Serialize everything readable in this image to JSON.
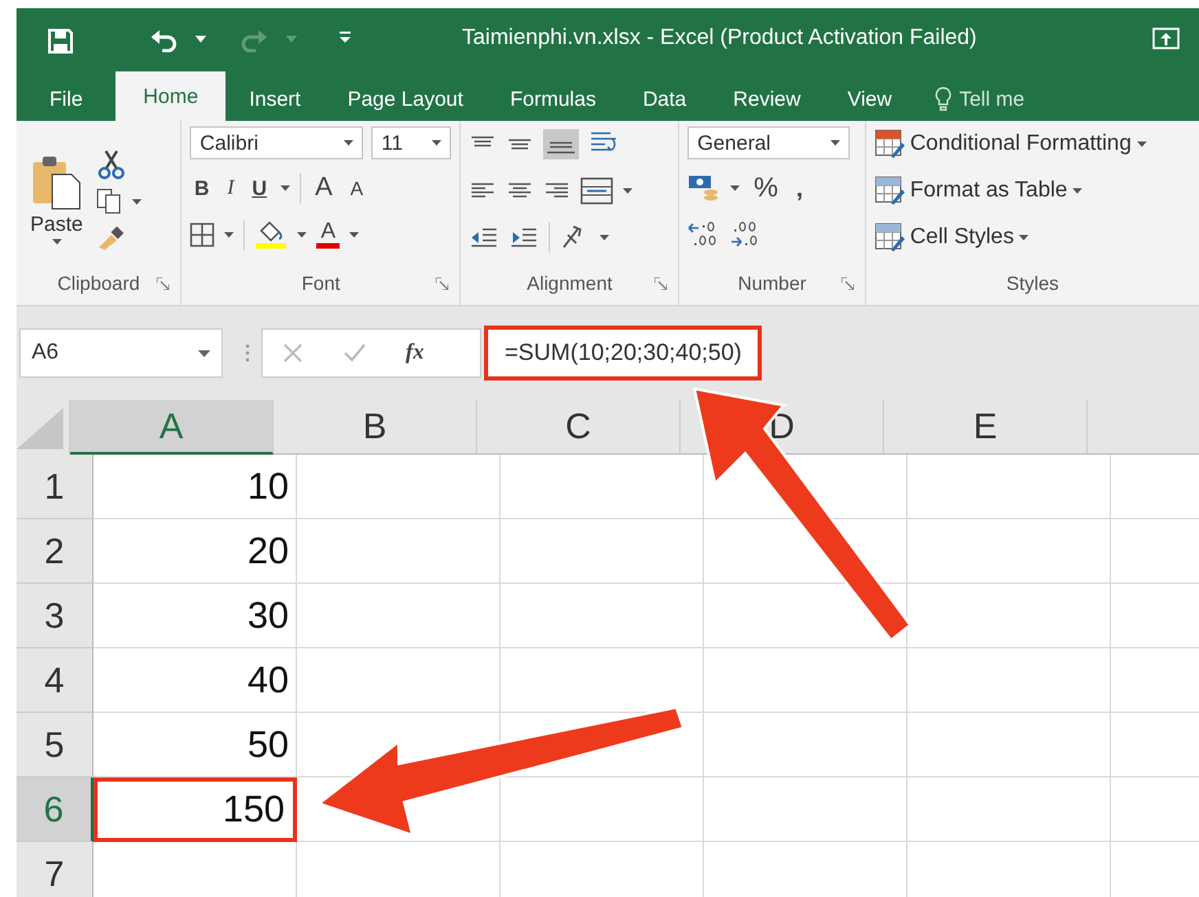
{
  "window": {
    "title": "Taimienphi.vn.xlsx - Excel (Product Activation Failed)"
  },
  "tabs": [
    {
      "label": "File",
      "selected": false
    },
    {
      "label": "Home",
      "selected": true
    },
    {
      "label": "Insert",
      "selected": false
    },
    {
      "label": "Page Layout",
      "selected": false
    },
    {
      "label": "Formulas",
      "selected": false
    },
    {
      "label": "Data",
      "selected": false
    },
    {
      "label": "Review",
      "selected": false
    },
    {
      "label": "View",
      "selected": false
    }
  ],
  "tell_me": "Tell me",
  "ribbon": {
    "clipboard": {
      "label": "Clipboard",
      "paste": "Paste"
    },
    "font": {
      "label": "Font",
      "name": "Calibri",
      "size": "11",
      "bold": "B",
      "italic": "I",
      "underline": "U",
      "grow": "A",
      "shrink": "A",
      "font_color": "A"
    },
    "alignment": {
      "label": "Alignment"
    },
    "number": {
      "label": "Number",
      "format": "General",
      "percent": "%",
      "comma": ","
    },
    "styles": {
      "label": "Styles",
      "items": [
        "Conditional Formatting",
        "Format as Table",
        "Cell Styles"
      ]
    }
  },
  "formula_bar": {
    "name_box": "A6",
    "fx": "fx",
    "formula": "=SUM(10;20;30;40;50)",
    "highlighted": true
  },
  "columns": [
    {
      "label": "A",
      "selected": true
    },
    {
      "label": "B",
      "selected": false
    },
    {
      "label": "C",
      "selected": false
    },
    {
      "label": "D",
      "selected": false
    },
    {
      "label": "E",
      "selected": false
    }
  ],
  "rows": [
    {
      "number": "1",
      "value": "10",
      "selected": false
    },
    {
      "number": "2",
      "value": "20",
      "selected": false
    },
    {
      "number": "3",
      "value": "30",
      "selected": false
    },
    {
      "number": "4",
      "value": "40",
      "selected": false
    },
    {
      "number": "5",
      "value": "50",
      "selected": false
    },
    {
      "number": "6",
      "value": "150",
      "selected": true
    },
    {
      "number": "7",
      "selected": false
    }
  ]
}
